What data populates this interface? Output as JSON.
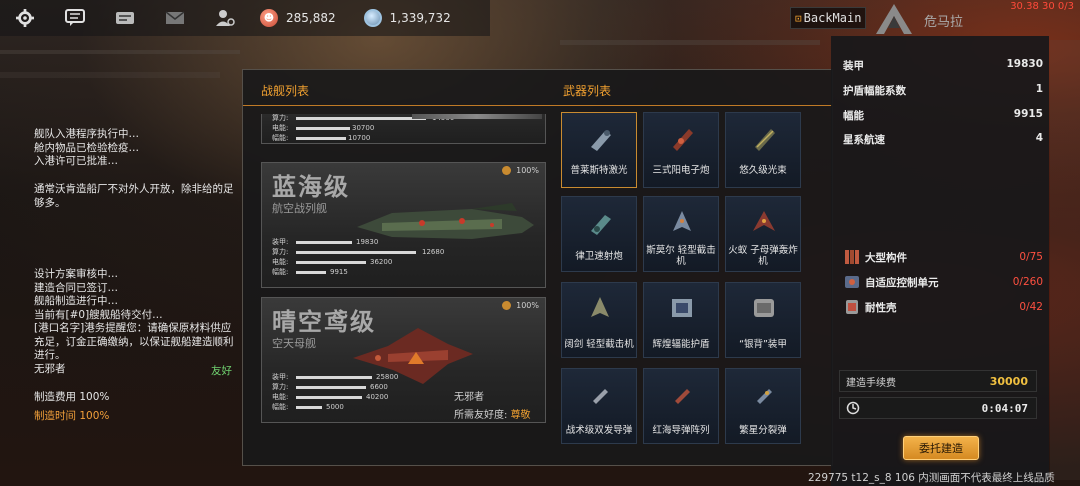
{
  "topbar": {
    "icons": [
      "gear-icon",
      "chat-icon",
      "mail-list-icon",
      "envelope-icon",
      "user-settings-icon"
    ],
    "resources": [
      {
        "name": "red-resource-icon",
        "value": "285,882"
      },
      {
        "name": "blue-resource-icon",
        "value": "1,339,732"
      }
    ],
    "back_label": "BackMain",
    "location": "危马拉",
    "fps": "30.38 30 0/3"
  },
  "log": {
    "p1": [
      "舰队入港程序执行中…",
      "舱内物品已检验检疫…",
      "入港许可已批准…"
    ],
    "p2": [
      "通常沃肯造船厂不对外人开放，除非给的足够多。"
    ],
    "p3": [
      "设计方案审核中…",
      "建造合同已签订…",
      "舰船制造进行中…",
      "当前有[#0]艘舰船待交付…",
      "[港口名字]港务提醒您：请确保原材料供应充足，订金正确缴纳，以保证舰船建造顺利进行。",
      "无邪者"
    ],
    "friend_label": "友好",
    "cost_fee": "制造费用 100%",
    "cost_time": "制造时间 100%"
  },
  "panel": {
    "ship_list_label": "战舰列表",
    "weapon_list_label": "武器列表"
  },
  "ships": {
    "partial": {
      "stats": [
        {
          "label": "算力:",
          "value": "14500",
          "fill": 0.78
        },
        {
          "label": "电能:",
          "value": "30700",
          "fill": 0.32
        },
        {
          "label": "幅能:",
          "value": "10700",
          "fill": 0.3
        }
      ]
    },
    "c1": {
      "name": "蓝海级",
      "class": "航空战列舰",
      "pct": "100%",
      "stats": [
        {
          "label": "装甲:",
          "value": "19830",
          "fill": 0.38
        },
        {
          "label": "算力:",
          "value": "12680",
          "fill": 0.72
        },
        {
          "label": "电能:",
          "value": "36200",
          "fill": 0.32
        },
        {
          "label": "幅能:",
          "value": "9915",
          "fill": 0.23
        }
      ]
    },
    "c2": {
      "name": "晴空鸢级",
      "class": "空天母舰",
      "pct": "100%",
      "owner": "无邪者",
      "favor_label": "所需友好度:",
      "favor_value": "尊敬",
      "stats": [
        {
          "label": "装甲:",
          "value": "25800",
          "fill": 0.42
        },
        {
          "label": "算力:",
          "value": "6600",
          "fill": 0.35
        },
        {
          "label": "电能:",
          "value": "40200",
          "fill": 0.32
        },
        {
          "label": "幅能:",
          "value": "5000",
          "fill": 0.14
        }
      ]
    }
  },
  "weapons": [
    "普莱斯特激光",
    "三式阳电子炮",
    "悠久级光束",
    "律卫速射炮",
    "斯莫尔 轻型截击机",
    "火蚁 子母弹轰炸机",
    "阔剑 轻型截击机",
    "辉煌辐能护盾",
    "“银背”装甲",
    "战术级双发导弹",
    "红海导弹阵列",
    "繁星分裂弹"
  ],
  "stats_panel": {
    "armor_label": "装甲",
    "armor_value": "19830",
    "shield_label": "护盾幅能系数",
    "shield_value": "1",
    "flux_label": "幅能",
    "flux_value": "9915",
    "speed_label": "星系航速",
    "speed_value": "4"
  },
  "materials": [
    {
      "label": "大型构件",
      "value": "0/75"
    },
    {
      "label": "自适应控制单元",
      "value": "0/260"
    },
    {
      "label": "耐性壳",
      "value": "0/42"
    }
  ],
  "fee": {
    "label": "建造手续费",
    "value": "30000"
  },
  "timer": {
    "value": "0:04:07"
  },
  "commission_label": "委托建造",
  "footer": "229775 t12_s_8 106  内测画面不代表最终上线品质"
}
